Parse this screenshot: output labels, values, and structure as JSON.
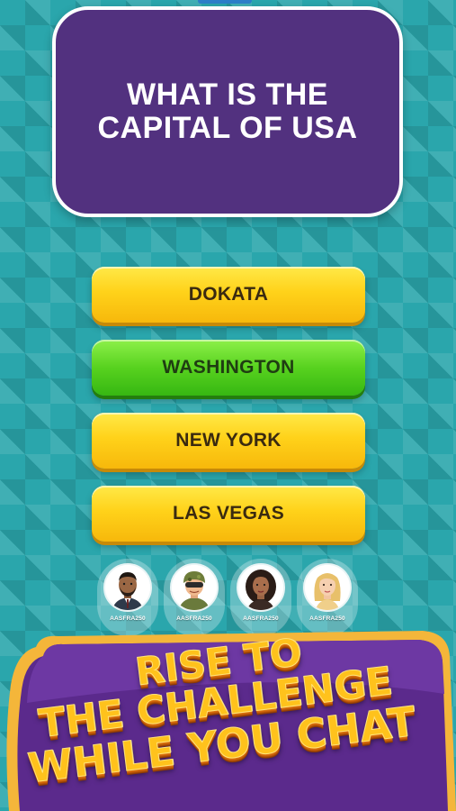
{
  "question": {
    "text": "WHAT IS THE CAPITAL OF USA"
  },
  "answers": [
    {
      "label": "DOKATA",
      "state": "default",
      "color": "#ffd21a"
    },
    {
      "label": "WASHINGTON",
      "state": "correct",
      "color": "#58d21f"
    },
    {
      "label": "NEW YORK",
      "state": "default",
      "color": "#ffd21a"
    },
    {
      "label": "LAS VEGAS",
      "state": "default",
      "color": "#ffd21a"
    }
  ],
  "players": [
    {
      "name": "AASFRA250",
      "avatar": "man-beard-avatar"
    },
    {
      "name": "AASFRA250",
      "avatar": "soldier-avatar"
    },
    {
      "name": "AASFRA250",
      "avatar": "woman-curly-hair-avatar"
    },
    {
      "name": "AASFRA250",
      "avatar": "blonde-woman-avatar"
    }
  ],
  "promo": {
    "line1": "RISE TO",
    "line2": "THE CHALLENGE",
    "line3": "WHILE YOU CHAT"
  },
  "colors": {
    "background": "#2aa6ac",
    "question_card": "#52317f",
    "banner_purple": "#5b2a8c",
    "banner_gold": "#f4b63a",
    "slogan": "#ffc21c"
  }
}
